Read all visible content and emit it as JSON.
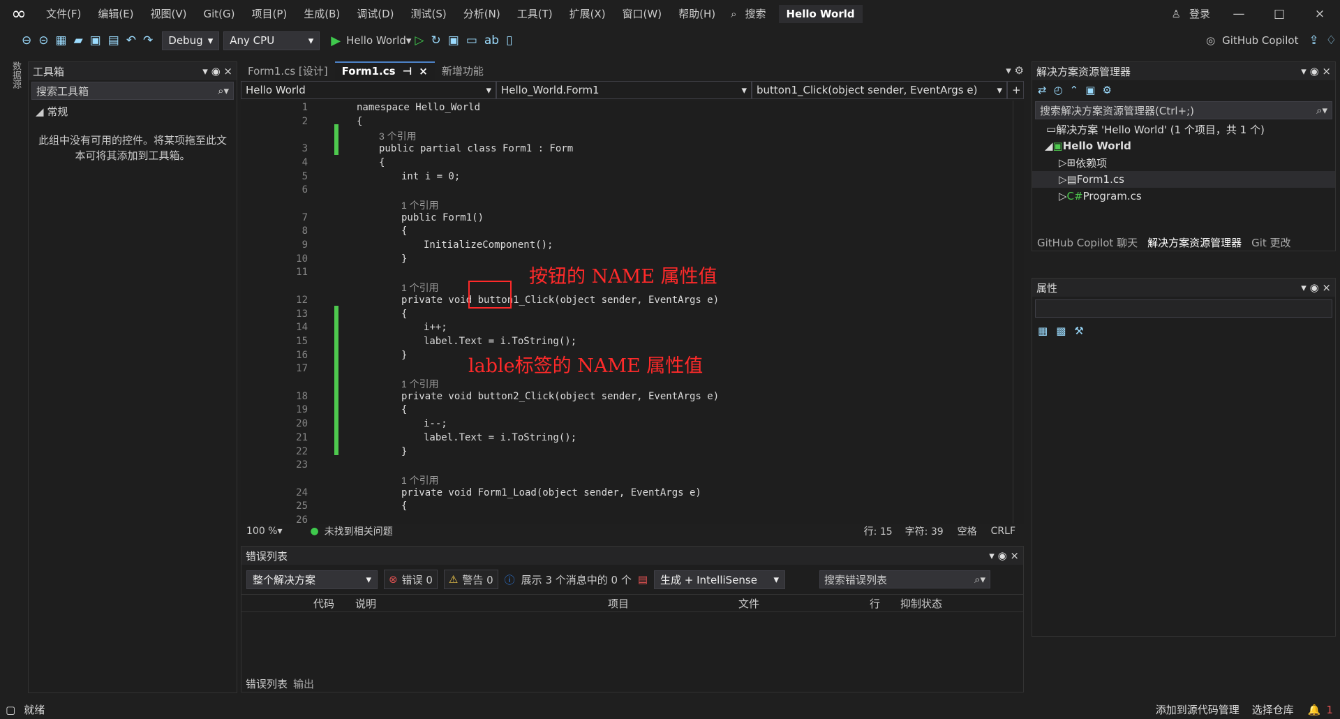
{
  "app": {
    "title": "Hello World",
    "menus": [
      "文件(F)",
      "编辑(E)",
      "视图(V)",
      "Git(G)",
      "项目(P)",
      "生成(B)",
      "调试(D)",
      "测试(S)",
      "分析(N)",
      "工具(T)",
      "扩展(X)",
      "窗口(W)",
      "帮助(H)"
    ],
    "search": "搜索",
    "login": "登录"
  },
  "toolbar": {
    "config": "Debug",
    "platform": "Any CPU",
    "run": "Hello World",
    "copilot": "GitHub Copilot"
  },
  "left": {
    "side_tab": "数据源",
    "title": "工具箱",
    "search": "搜索工具箱",
    "group": "常规",
    "empty": "此组中没有可用的控件。将某项拖至此文本可将其添加到工具箱。"
  },
  "editor": {
    "tabs": [
      "Form1.cs [设计]",
      "Form1.cs",
      "新增功能"
    ],
    "nav": [
      "Hello World",
      "Hello_World.Form1",
      "button1_Click(object sender, EventArgs e)"
    ],
    "lines": [
      {
        "n": "1",
        "text": "namespace Hello_World"
      },
      {
        "n": "2",
        "text": "{"
      },
      {
        "n": "",
        "text": "3 个引用",
        "ref": true
      },
      {
        "n": "3",
        "text": "public partial class Form1 : Form"
      },
      {
        "n": "4",
        "text": "{"
      },
      {
        "n": "5",
        "text": "int i = 0;"
      },
      {
        "n": "6",
        "text": ""
      },
      {
        "n": "",
        "text": "1 个引用",
        "ref": true
      },
      {
        "n": "7",
        "text": "public Form1()"
      },
      {
        "n": "8",
        "text": "{"
      },
      {
        "n": "9",
        "text": "InitializeComponent();"
      },
      {
        "n": "10",
        "text": "}"
      },
      {
        "n": "11",
        "text": ""
      },
      {
        "n": "",
        "text": "1 个引用",
        "ref": true
      },
      {
        "n": "12",
        "text": "private void button1_Click(object sender, EventArgs e)"
      },
      {
        "n": "13",
        "text": "{"
      },
      {
        "n": "14",
        "text": "i++;"
      },
      {
        "n": "15",
        "text": "label.Text = i.ToString();"
      },
      {
        "n": "16",
        "text": "}"
      },
      {
        "n": "17",
        "text": ""
      },
      {
        "n": "",
        "text": "1 个引用",
        "ref": true
      },
      {
        "n": "18",
        "text": "private void button2_Click(object sender, EventArgs e)"
      },
      {
        "n": "19",
        "text": "{"
      },
      {
        "n": "20",
        "text": "i--;"
      },
      {
        "n": "21",
        "text": "label.Text = i.ToString();"
      },
      {
        "n": "22",
        "text": "}"
      },
      {
        "n": "23",
        "text": ""
      },
      {
        "n": "",
        "text": "1 个引用",
        "ref": true
      },
      {
        "n": "24",
        "text": "private void Form1_Load(object sender, EventArgs e)"
      },
      {
        "n": "25",
        "text": "{"
      },
      {
        "n": "26",
        "text": ""
      }
    ],
    "annotations": [
      "按钮的 NAME 属性值",
      "lable标签的 NAME 属性值"
    ],
    "zoom": "100 %",
    "issues": "未找到相关问题",
    "line": "行: 15",
    "char": "字符: 39",
    "space": "空格",
    "eol": "CRLF"
  },
  "errors": {
    "title": "错误列表",
    "scope": "整个解决方案",
    "error": "错误 0",
    "warning": "警告 0",
    "info": "展示 3 个消息中的 0 个",
    "build": "生成 + IntelliSense",
    "search": "搜索错误列表",
    "columns": [
      "代码",
      "说明",
      "项目",
      "文件",
      "行",
      "抑制状态"
    ],
    "tabs": [
      "错误列表",
      "输出"
    ]
  },
  "solution": {
    "title": "解决方案资源管理器",
    "search": "搜索解决方案资源管理器(Ctrl+;)",
    "items": [
      "解决方案 'Hello World' (1 个项目，共 1 个)",
      "Hello World",
      "依赖项",
      "Form1.cs",
      "Program.cs"
    ],
    "tabs": [
      "GitHub Copilot 聊天",
      "解决方案资源管理器",
      "Git 更改"
    ]
  },
  "properties": {
    "title": "属性"
  },
  "status": {
    "left": "就绪",
    "source": "添加到源代码管理",
    "repo": "选择仓库",
    "notify": "1"
  }
}
